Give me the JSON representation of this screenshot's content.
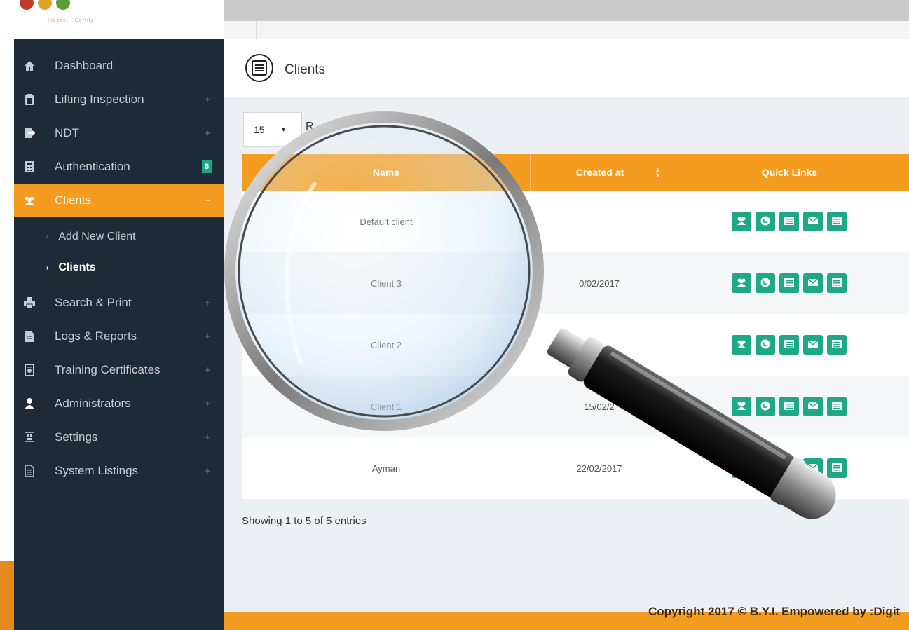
{
  "brand": {
    "tagline": "Inspect - Certify",
    "dot_colors": [
      "#c0392b",
      "#e0a526",
      "#5b9b3a"
    ]
  },
  "sidebar": {
    "items": [
      {
        "label": "Dashboard",
        "icon": "home-icon",
        "expand": ""
      },
      {
        "label": "Lifting Inspection",
        "icon": "clipboard-icon",
        "expand": "+"
      },
      {
        "label": "NDT",
        "icon": "sign-in-icon",
        "expand": "+"
      },
      {
        "label": "Authentication",
        "icon": "calculator-icon",
        "badge": "5"
      },
      {
        "label": "Clients",
        "icon": "users-icon",
        "expand": "−"
      },
      {
        "label": "Search & Print",
        "icon": "print-icon",
        "expand": "+"
      },
      {
        "label": "Logs & Reports",
        "icon": "file-icon",
        "expand": "+"
      },
      {
        "label": "Training Certificates",
        "icon": "certificate-icon",
        "expand": "+"
      },
      {
        "label": "Administrators",
        "icon": "user-icon",
        "expand": "+"
      },
      {
        "label": "Settings",
        "icon": "settings-icon",
        "expand": "+"
      },
      {
        "label": "System Listings",
        "icon": "list-file-icon",
        "expand": "+"
      }
    ],
    "submenu": [
      {
        "label": "Add New Client"
      },
      {
        "label": "Clients"
      }
    ]
  },
  "page": {
    "title": "Clients"
  },
  "controls": {
    "per_page": "15",
    "records_partial": "R"
  },
  "table": {
    "columns": [
      "Name",
      "Created at",
      "Quick Links"
    ],
    "rows": [
      {
        "name": "Default client",
        "created": ""
      },
      {
        "name": "Client 3",
        "created": "0/02/2017"
      },
      {
        "name": "Client 2",
        "created": ""
      },
      {
        "name": "Client 1",
        "created": "15/02/2"
      },
      {
        "name": "Ayman",
        "created": "22/02/2017"
      }
    ],
    "quick_link_icons": [
      "users-icon",
      "globe-icon",
      "list-icon",
      "envelope-icon",
      "list-icon"
    ]
  },
  "pagination": {
    "info": "Showing 1 to 5 of 5 entries"
  },
  "footer": {
    "text": "Copyright 2017 © B.Y.I. Empowered by :Digit"
  }
}
